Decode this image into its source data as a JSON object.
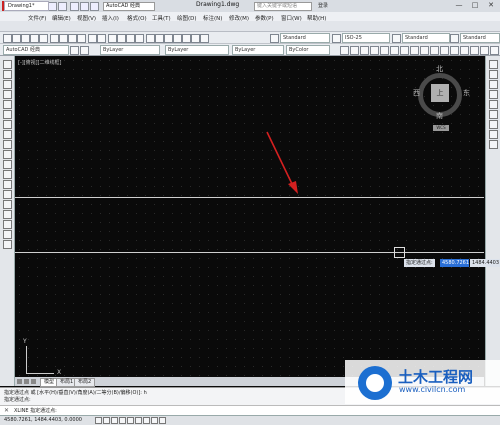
{
  "app": {
    "logo_letter": "A",
    "workspace": "AutoCAD 经典",
    "document_title": "Drawing1.dwg",
    "search_placeholder": "键入关键字或短语",
    "login": "登录",
    "window_controls": [
      "—",
      "□",
      "✕"
    ]
  },
  "menu": [
    "文件(F)",
    "编辑(E)",
    "视图(V)",
    "插入(I)",
    "格式(O)",
    "工具(T)",
    "绘图(D)",
    "标注(N)",
    "修改(M)",
    "参数(P)",
    "窗口(W)",
    "帮助(H)"
  ],
  "file_tab": "Drawing1*",
  "toolbar2": {
    "workspace": "AutoCAD 经典",
    "layer": "ByLayer",
    "linetype": "ByLayer",
    "lineweight": "ByLayer",
    "plotstyle": "ByColor"
  },
  "toolbar1": {
    "text_style": "Standard",
    "dim_style": "ISO-25",
    "table_style": "Standard",
    "mleader_style": "Standard"
  },
  "canvas": {
    "view_label": "[-][俯视][二维线框]",
    "viewcube": {
      "top": "上",
      "north": "北",
      "south": "南",
      "east": "东",
      "west": "西",
      "wcs": "WCS"
    },
    "dynamic_prompt": "指定通过点:",
    "input_value_1": "4580.7261",
    "input_value_2": "1484.4403",
    "ucs_x": "X",
    "ucs_y": "Y"
  },
  "layout_tabs": [
    "模型",
    "布局1",
    "布局2"
  ],
  "command": {
    "history_1": "指定通过点 或 [水平(H)/垂直(V)/角度(A)/二等分(B)/偏移(O)]: h",
    "history_2": "指定通过点:",
    "input": "XLINE 指定通过点:"
  },
  "status": {
    "coords": "4580.7261, 1484.4403, 0.0000"
  },
  "watermark": {
    "title": "土木工程网",
    "url": "www.civilcn.com"
  },
  "colors": {
    "canvas_bg": "#0a0a0a",
    "input_highlight": "#2a6fd6",
    "arrow": "#d42020",
    "watermark": "#1a5fbf"
  }
}
